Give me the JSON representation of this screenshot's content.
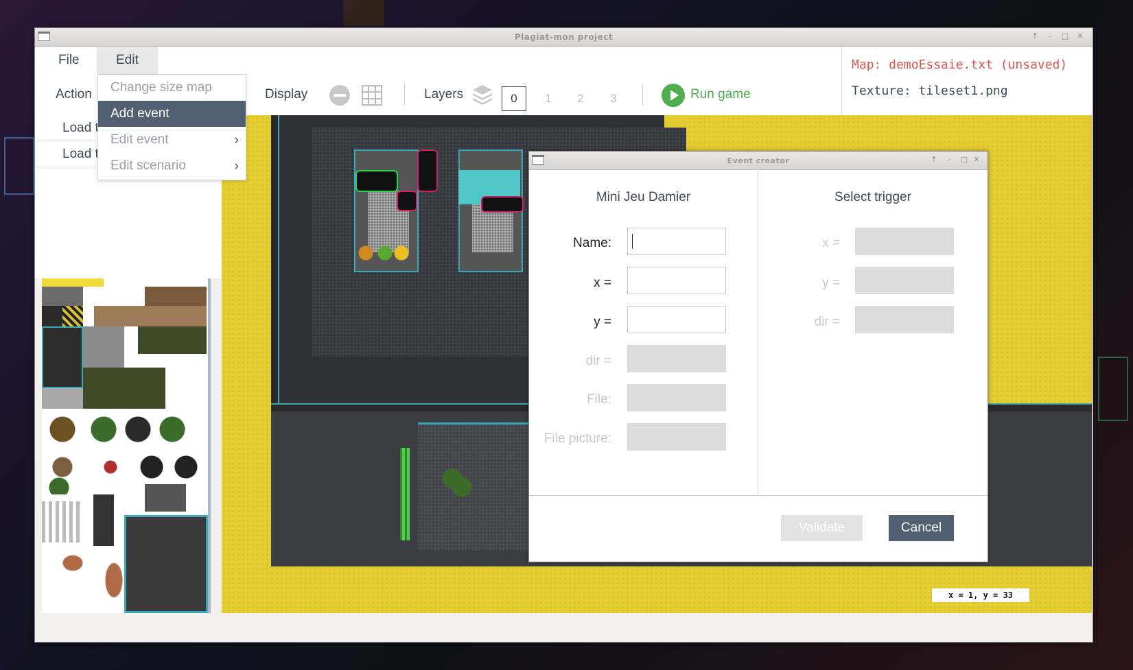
{
  "window": {
    "title": "Plagiat-mon project",
    "controls": [
      "↑",
      "–",
      "□",
      "✕"
    ]
  },
  "menubar": {
    "file_label": "File",
    "edit_label": "Edit"
  },
  "toolbar": {
    "action_label": "Action",
    "display_label": "Display",
    "layers_label": "Layers",
    "layers": [
      "0",
      "1",
      "2",
      "3"
    ],
    "selected_layer": "0",
    "run_game_label": "Run game"
  },
  "info": {
    "map_text": "Map: demoEssaie.txt (unsaved)",
    "texture_text": "Texture: tileset1.png",
    "map_color": "#d9534f",
    "texture_color": "#3d4a56"
  },
  "left_panel": {
    "buttons": [
      "Load t",
      "Load te"
    ]
  },
  "edit_menu": {
    "items": [
      {
        "label": "Change size map",
        "submenu": false
      },
      {
        "label": "Add event",
        "submenu": false
      },
      {
        "label": "Edit event",
        "submenu": true
      },
      {
        "label": "Edit scenario",
        "submenu": true
      }
    ],
    "highlighted": "Add event"
  },
  "event_dialog": {
    "title": "Event creator",
    "left_title": "Mini Jeu Damier",
    "right_title": "Select trigger",
    "fields": [
      {
        "label": "Name:",
        "value": "",
        "enabled": true
      },
      {
        "label": "x =",
        "value": "",
        "enabled": true
      },
      {
        "label": "y =",
        "value": "",
        "enabled": true
      },
      {
        "label": "dir =",
        "value": "",
        "enabled": false
      },
      {
        "label": "File:",
        "value": "",
        "enabled": false
      },
      {
        "label": "File picture:",
        "value": "",
        "enabled": false
      }
    ],
    "trigger_fields": [
      {
        "label": "x =",
        "enabled": false
      },
      {
        "label": "y =",
        "enabled": false
      },
      {
        "label": "dir =",
        "enabled": false
      }
    ],
    "validate_label": "Validate",
    "cancel_label": "Cancel"
  },
  "status": {
    "coords_text": "x = 1, y = 33"
  },
  "colors": {
    "accent_dark": "#506070",
    "run_green": "#4cae4c",
    "map_yellow": "#e4cd32"
  }
}
